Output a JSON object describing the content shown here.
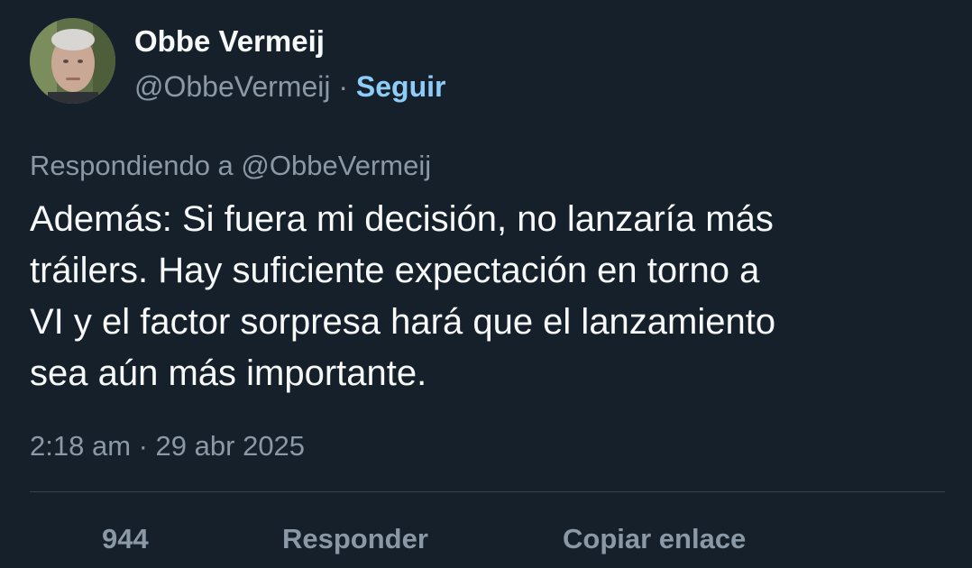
{
  "author": {
    "display_name": "Obbe Vermeij",
    "handle": "@ObbeVermeij",
    "separator": "·",
    "follow_label": "Seguir"
  },
  "reply_context": {
    "prefix": "Respondiendo a",
    "mention": "@ObbeVermeij"
  },
  "tweet": {
    "text": "Además: Si fuera mi decisión, no lanzaría más\ntráilers. Hay suficiente expectación en torno a\nVI y el factor sorpresa hará que el lanzamiento\nsea aún más importante.",
    "timestamp": "2:18 am · 29 abr 2025"
  },
  "actions": {
    "likes_count": "944",
    "reply_label": "Responder",
    "copy_link_label": "Copiar enlace"
  },
  "colors": {
    "background": "#15202b",
    "text_primary": "#f7f9f9",
    "text_secondary": "#8b98a5",
    "accent": "#8ecdf8",
    "divider": "#38444d"
  }
}
